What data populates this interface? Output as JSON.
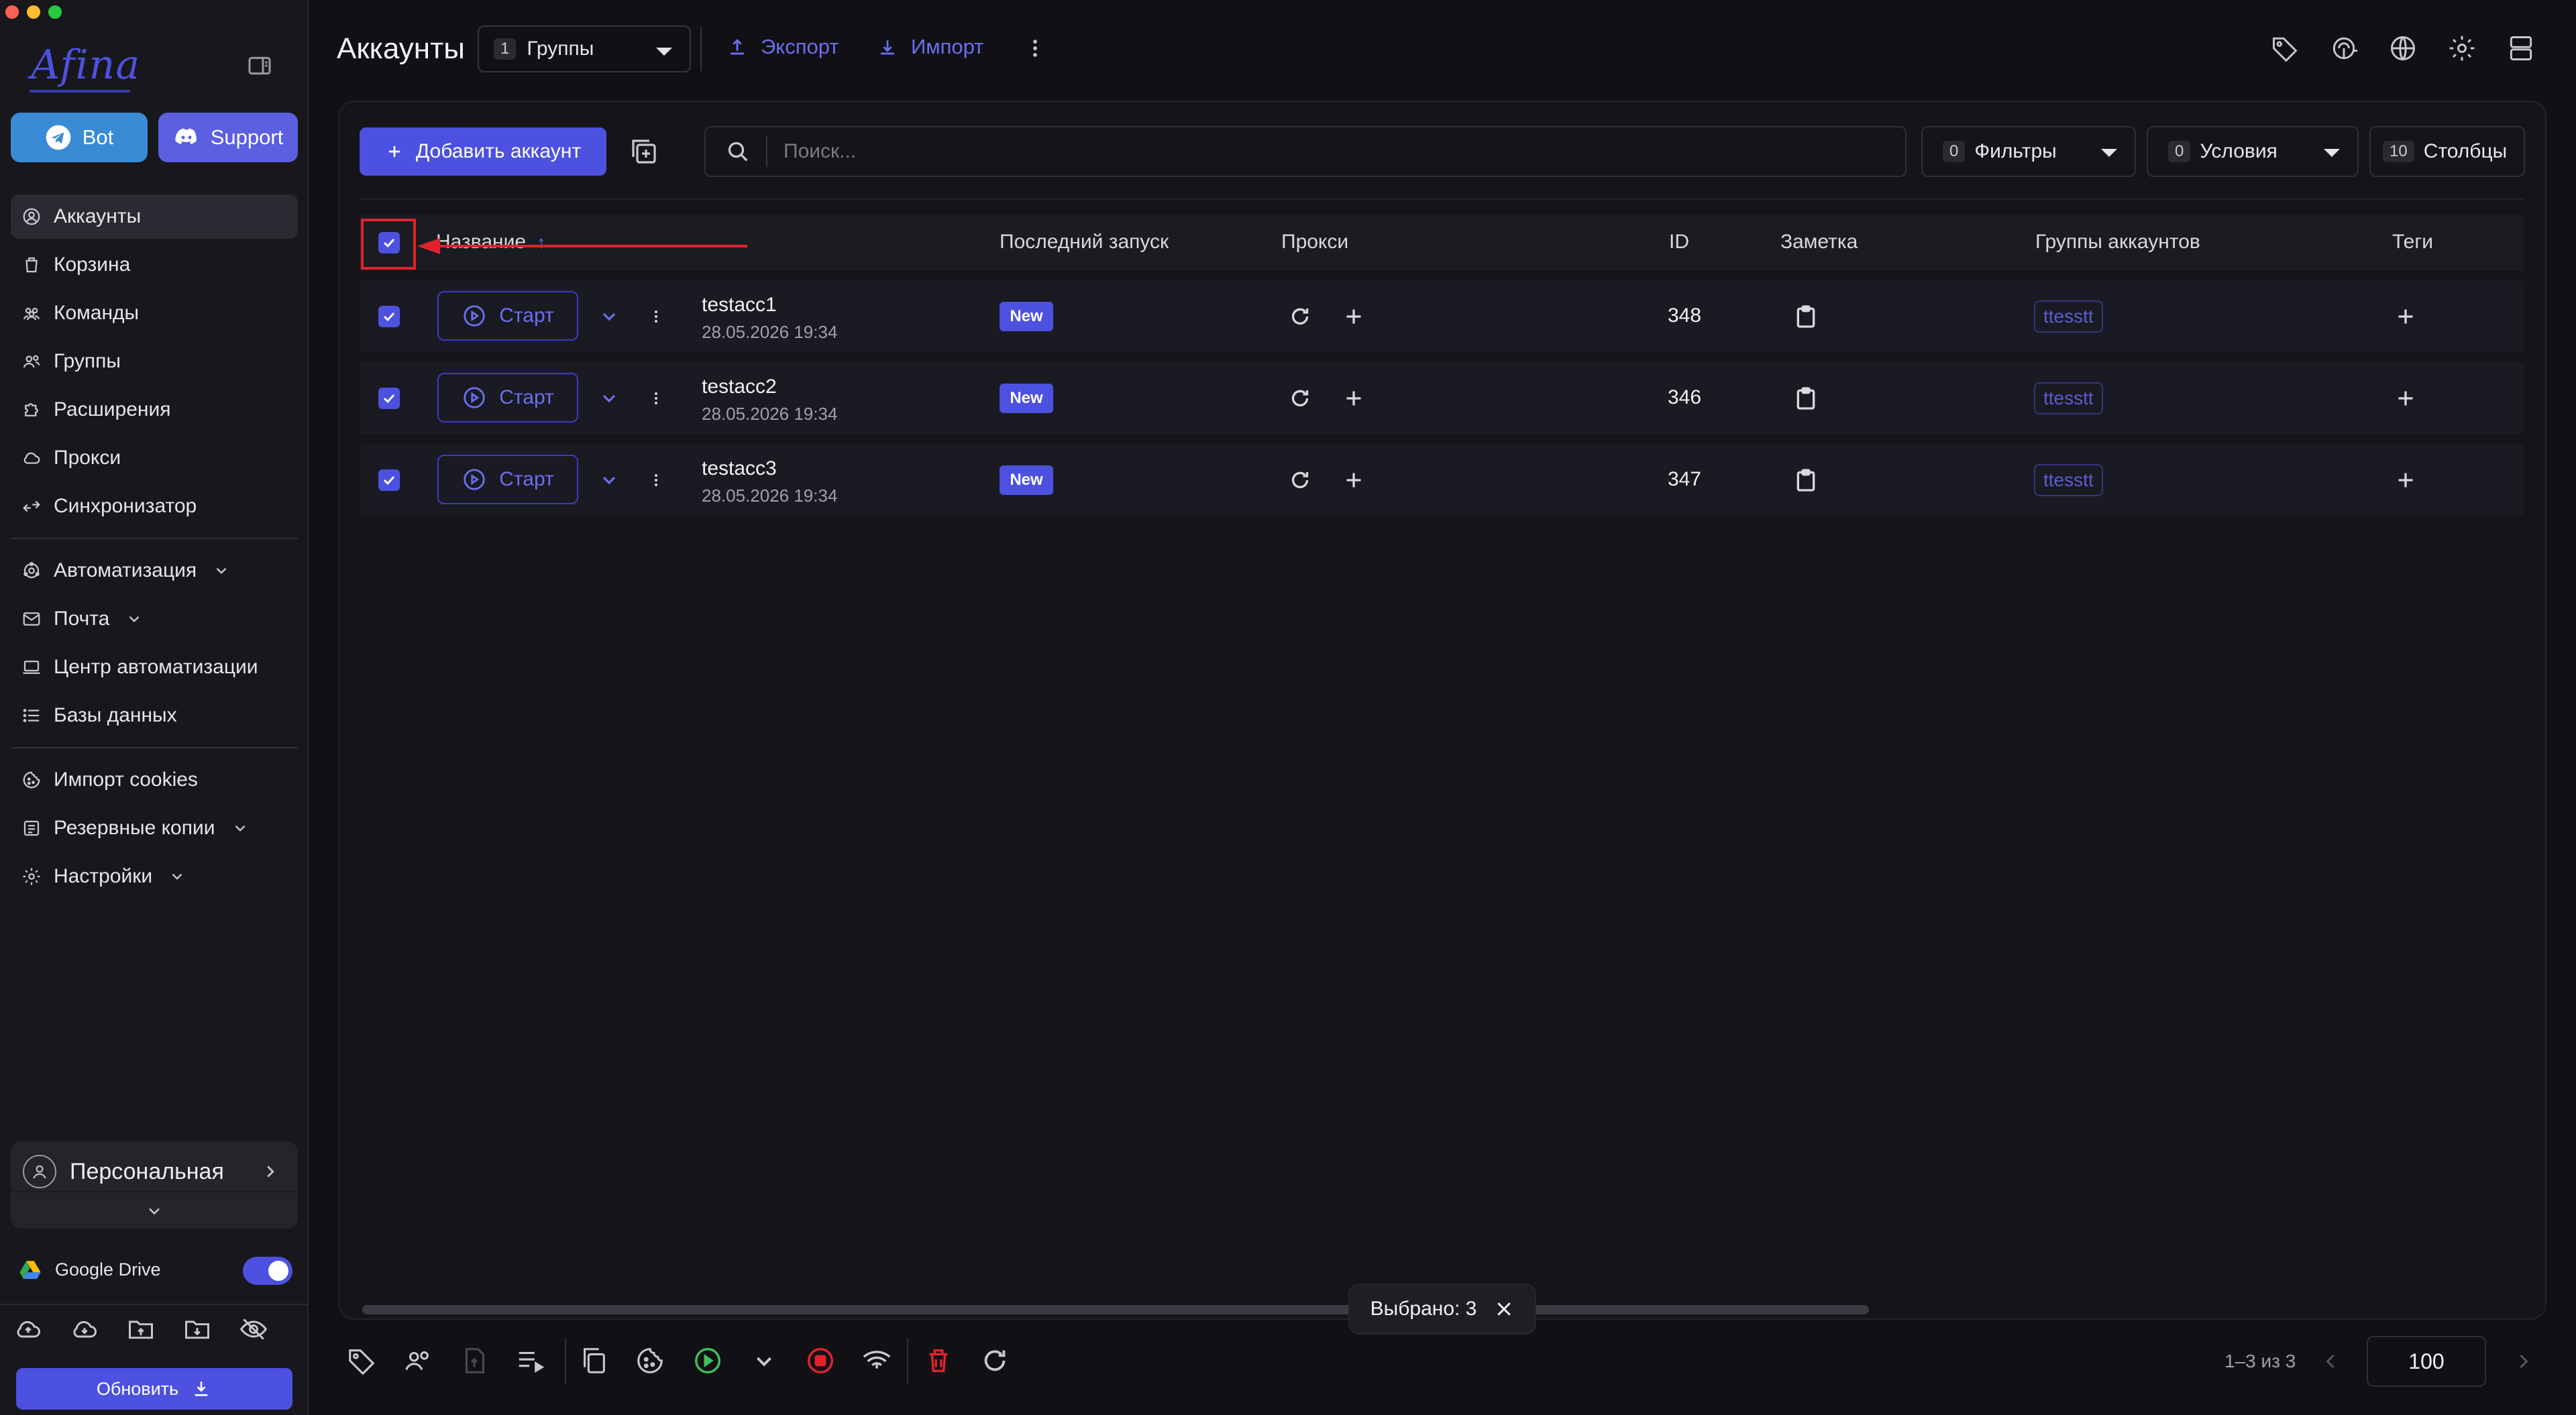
{
  "app": {
    "logo": "Afina",
    "page_title": "Аккаунты"
  },
  "sidebar": {
    "bot_label": "Bot",
    "support_label": "Support",
    "items": [
      {
        "label": "Аккаунты",
        "icon": "user-circle-icon"
      },
      {
        "label": "Корзина",
        "icon": "trash-icon"
      },
      {
        "label": "Команды",
        "icon": "team-icon"
      },
      {
        "label": "Группы",
        "icon": "groups-icon"
      },
      {
        "label": "Расширения",
        "icon": "puzzle-icon"
      },
      {
        "label": "Прокси",
        "icon": "cloud-icon"
      },
      {
        "label": "Синхронизатор",
        "icon": "sync-icon"
      }
    ],
    "items2": [
      {
        "label": "Автоматизация",
        "icon": "automation-icon"
      },
      {
        "label": "Почта",
        "icon": "mail-icon"
      },
      {
        "label": "Центр автоматизации",
        "icon": "laptop-icon"
      },
      {
        "label": "Базы данных",
        "icon": "list-icon"
      }
    ],
    "items3": [
      {
        "label": "Импорт cookies",
        "icon": "cookie-icon"
      },
      {
        "label": "Резервные копии",
        "icon": "backup-icon"
      },
      {
        "label": "Настройки",
        "icon": "gear-icon"
      }
    ],
    "profile_name": "Персональная",
    "google_drive_label": "Google Drive",
    "google_drive_enabled": true,
    "update_label": "Обновить"
  },
  "header": {
    "groups_count": "1",
    "groups_label": "Группы",
    "export_label": "Экспорт",
    "import_label": "Импорт"
  },
  "toolbar": {
    "add_account_label": "Добавить аккаунт",
    "search_placeholder": "Поиск...",
    "filters_count": "0",
    "filters_label": "Фильтры",
    "conditions_count": "0",
    "conditions_label": "Условия",
    "columns_count": "10",
    "columns_label": "Столбцы"
  },
  "table": {
    "columns": {
      "name": "Название",
      "last_launch": "Последний запуск",
      "proxy": "Прокси",
      "id": "ID",
      "note": "Заметка",
      "account_groups": "Группы аккаунтов",
      "tags": "Теги"
    },
    "start_label": "Старт",
    "rows": [
      {
        "name": "testacc1",
        "date": "28.05.2026 19:34",
        "status": "New",
        "id": "348",
        "group": "ttesstt"
      },
      {
        "name": "testacc2",
        "date": "28.05.2026 19:34",
        "status": "New",
        "id": "346",
        "group": "ttesstt"
      },
      {
        "name": "testacc3",
        "date": "28.05.2026 19:34",
        "status": "New",
        "id": "347",
        "group": "ttesstt"
      }
    ]
  },
  "selection": {
    "label": "Выбрано: 3"
  },
  "pager": {
    "range": "1–3 из 3",
    "page_size": "100"
  },
  "colors": {
    "accent": "#4d51e0",
    "link": "#6b6ff0",
    "danger": "#e0232b",
    "success": "#3fbf5a"
  }
}
